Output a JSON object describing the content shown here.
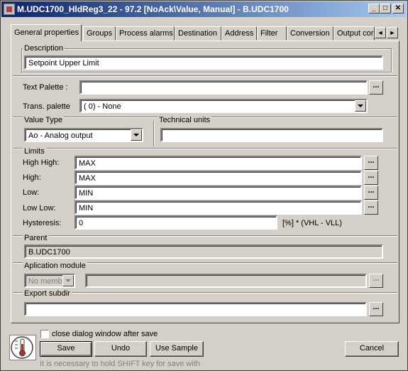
{
  "window": {
    "title": "M.UDC1700_HldReg3_22 - 97.2 [NoAck\\Value, Manual] - B.UDC1700",
    "minimize_glyph": "_",
    "maximize_glyph": "□",
    "close_glyph": "✕"
  },
  "tabs": [
    {
      "label": "General properties",
      "active": true
    },
    {
      "label": "Groups"
    },
    {
      "label": "Process alarms"
    },
    {
      "label": "Destination"
    },
    {
      "label": "Address"
    },
    {
      "label": "Filter"
    },
    {
      "label": "Conversion"
    },
    {
      "label": "Output cor"
    }
  ],
  "tab_scroll": {
    "left": "◄",
    "right": "►"
  },
  "description": {
    "legend": "Description",
    "value": "Setpoint Upper Limit"
  },
  "text_palette": {
    "label": "Text Palette :",
    "value": "",
    "browse": "..."
  },
  "trans_palette": {
    "label": "Trans. palette",
    "value": "( 0) - None"
  },
  "value_type": {
    "legend": "Value Type",
    "value": "Ao - Analog output"
  },
  "technical_units": {
    "legend": "Technical units",
    "value": ""
  },
  "limits": {
    "legend": "Limits",
    "high_high": {
      "label": "High High:",
      "value": "MAX"
    },
    "high": {
      "label": "High:",
      "value": "MAX"
    },
    "low": {
      "label": "Low:",
      "value": "MIN"
    },
    "low_low": {
      "label": "Low Low:",
      "value": "MIN"
    },
    "hysteresis": {
      "label": "Hysteresis:",
      "value": "0",
      "suffix": "[%] * (VHL - VLL)"
    },
    "browse": "..."
  },
  "parent": {
    "legend": "Parent",
    "value": "B.UDC1700"
  },
  "aplication_module": {
    "legend": "Aplication module",
    "combo_value": "No member",
    "value": "",
    "browse": "..."
  },
  "export_subdir": {
    "legend": "Export subdir",
    "value": "",
    "browse": "..."
  },
  "footer": {
    "close_after_save_label": "close dialog window after save",
    "close_after_save_checked": false,
    "save": "Save",
    "undo": "Undo",
    "use_sample": "Use Sample",
    "cancel": "Cancel",
    "hint": "It is necessary to hold SHIFT key for save with"
  }
}
